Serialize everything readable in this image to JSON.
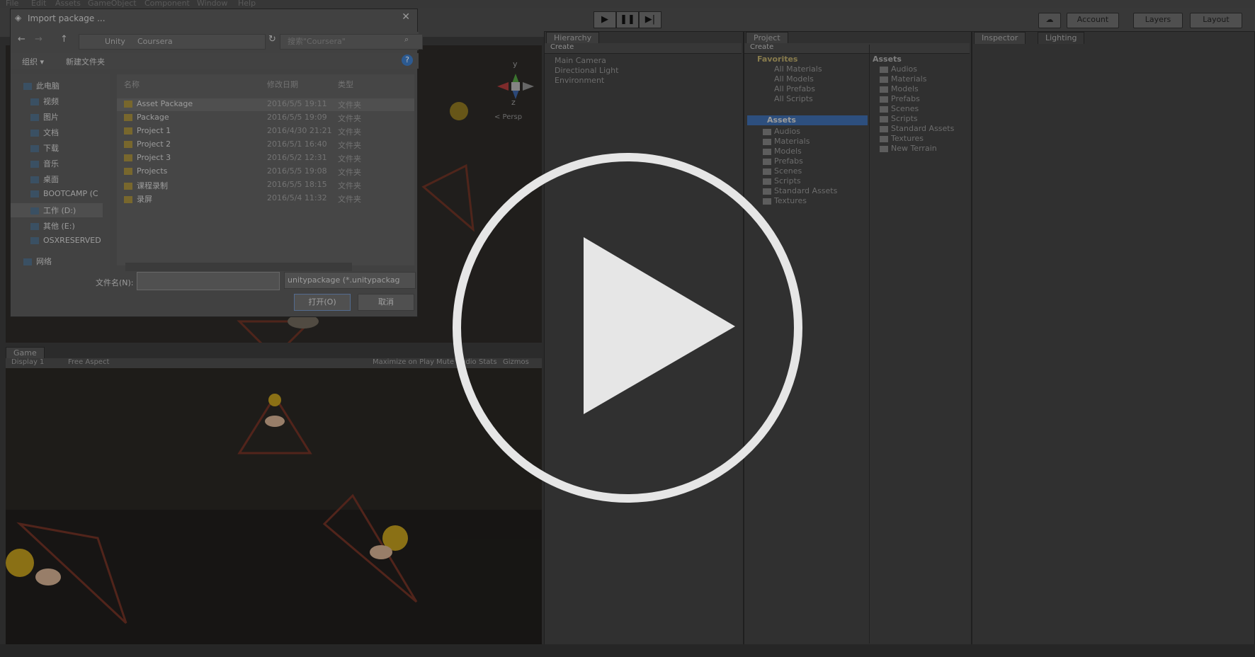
{
  "menubar": {
    "items": [
      "File",
      "Edit",
      "Assets",
      "GameObject",
      "Component",
      "Window",
      "Help"
    ]
  },
  "toolbar": {
    "account": "Account",
    "layers": "Layers",
    "layout": "Layout"
  },
  "play_controls": {
    "play": "▶",
    "pause": "❚❚",
    "step": "▶|"
  },
  "hierarchy": {
    "tab": "Hierarchy",
    "create": "Create",
    "items": [
      "Main Camera",
      "Directional Light",
      "Environment"
    ]
  },
  "project": {
    "tab": "Project",
    "create": "Create",
    "favorites_label": "Favorites",
    "favorites": [
      "All Materials",
      "All Models",
      "All Prefabs",
      "All Scripts"
    ],
    "assets_label": "Assets",
    "asset_folders": [
      "Audios",
      "Materials",
      "Models",
      "Prefabs",
      "Scenes",
      "Scripts",
      "Standard Assets",
      "Textures"
    ],
    "right_header": "Assets",
    "right_items": [
      "Audios",
      "Materials",
      "Models",
      "Prefabs",
      "Scenes",
      "Scripts",
      "Standard Assets",
      "Textures",
      "New Terrain"
    ]
  },
  "inspector": {
    "tab": "Inspector",
    "lighting_tab": "Lighting"
  },
  "scene": {
    "persp_label": "< Persp",
    "axis_y": "y",
    "axis_z": "z"
  },
  "game": {
    "tab": "Game",
    "display": "Display 1",
    "aspect": "Free Aspect",
    "maximize": "Maximize on Play",
    "mute": "Mute Audio",
    "stats": "Stats",
    "gizmos": "Gizmos"
  },
  "dialog": {
    "title": "Import package ...",
    "breadcrumb": [
      "Unity",
      "Coursera"
    ],
    "search_placeholder": "搜索\"Coursera\"",
    "organize": "组织 ▾",
    "new_folder": "新建文件夹",
    "nav": [
      "此电脑",
      "视频",
      "图片",
      "文档",
      "下载",
      "音乐",
      "桌面",
      "BOOTCAMP (C",
      "工作 (D:)",
      "其他 (E:)",
      "OSXRESERVED",
      "网络"
    ],
    "columns": {
      "name": "名称",
      "date": "修改日期",
      "type": "类型"
    },
    "files": [
      {
        "name": "Asset Package",
        "date": "2016/5/5 19:11",
        "type": "文件夹"
      },
      {
        "name": "Package",
        "date": "2016/5/5 19:09",
        "type": "文件夹"
      },
      {
        "name": "Project 1",
        "date": "2016/4/30 21:21",
        "type": "文件夹"
      },
      {
        "name": "Project 2",
        "date": "2016/5/1 16:40",
        "type": "文件夹"
      },
      {
        "name": "Project 3",
        "date": "2016/5/2 12:31",
        "type": "文件夹"
      },
      {
        "name": "Projects",
        "date": "2016/5/5 19:08",
        "type": "文件夹"
      },
      {
        "name": "课程录制",
        "date": "2016/5/5 18:15",
        "type": "文件夹"
      },
      {
        "name": "录屏",
        "date": "2016/5/4 11:32",
        "type": "文件夹"
      }
    ],
    "filename_label": "文件名(N):",
    "filename_value": "",
    "filter": "unitypackage (*.unitypackag",
    "open": "打开(O)",
    "cancel": "取消"
  },
  "colors": {
    "accent_selection": "#3d6aa8",
    "folder": "#a08a3c",
    "coin": "#c9a520",
    "ladder": "#8c3b2c"
  },
  "icons": [
    "unity-icon",
    "back-icon",
    "forward-icon",
    "up-icon",
    "refresh-icon",
    "search-icon",
    "help-icon",
    "close-icon",
    "play-icon",
    "cloud-icon"
  ]
}
